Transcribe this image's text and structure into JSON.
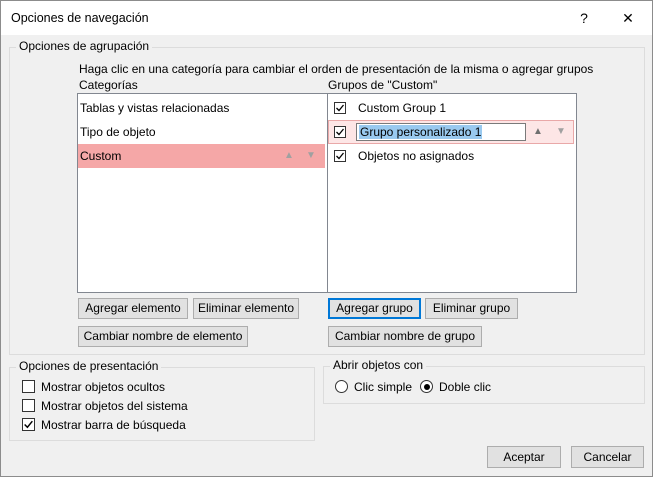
{
  "window": {
    "title": "Opciones de navegación",
    "help_icon": "?",
    "close_icon": "✕"
  },
  "grouping": {
    "label": "Opciones de agrupación",
    "instructions": "Haga clic en una categoría para cambiar el orden de presentación de la misma o agregar grupos",
    "categories_label": "Categorías",
    "categories": [
      {
        "label": "Tablas y vistas relacionadas",
        "selected": false
      },
      {
        "label": "Tipo de objeto",
        "selected": false
      },
      {
        "label": "Custom",
        "selected": true
      }
    ],
    "groups_label": "Grupos de \"Custom\"",
    "groups": [
      {
        "label": "Custom Group 1",
        "checked": true,
        "editing": false
      },
      {
        "label": "Grupo personalizado 1",
        "checked": true,
        "editing": true
      },
      {
        "label": "Objetos no asignados",
        "checked": true,
        "editing": false
      }
    ],
    "buttons": {
      "add_item": "Agregar elemento",
      "delete_item": "Eliminar elemento",
      "rename_item": "Cambiar nombre de elemento",
      "add_group": "Agregar grupo",
      "delete_group": "Eliminar grupo",
      "rename_group": "Cambiar nombre de grupo"
    },
    "arrow_up": "▲",
    "arrow_down": "▼"
  },
  "display": {
    "label": "Opciones de presentación",
    "options": [
      {
        "label": "Mostrar objetos ocultos",
        "checked": false
      },
      {
        "label": "Mostrar objetos del sistema",
        "checked": false
      },
      {
        "label": "Mostrar barra de búsqueda",
        "checked": true
      }
    ]
  },
  "open": {
    "label": "Abrir objetos con",
    "options": [
      {
        "label": "Clic simple",
        "selected": false
      },
      {
        "label": "Doble clic",
        "selected": true
      }
    ]
  },
  "footer": {
    "ok": "Aceptar",
    "cancel": "Cancelar"
  },
  "colors": {
    "selection": "#f5a7a7",
    "text_selection": "#99c9ef",
    "focus": "#0078d7"
  }
}
